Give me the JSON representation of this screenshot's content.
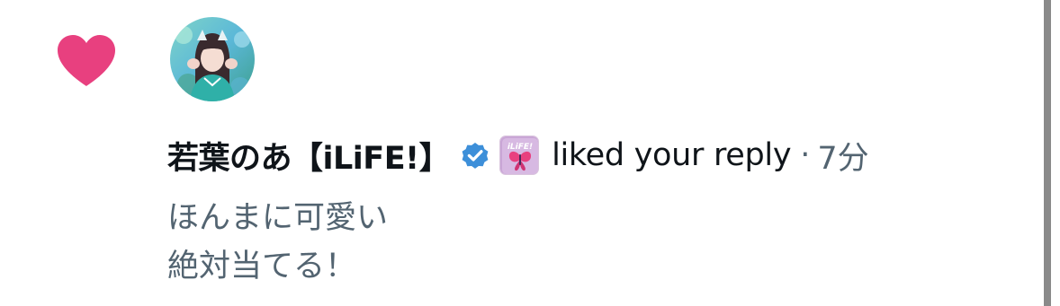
{
  "notification": {
    "type_icon": "heart-icon",
    "accent_color": "#e8407f",
    "avatar": {
      "description_icon": "user-avatar-photo"
    },
    "user": {
      "display_name": "若葉のあ【iLiFE!】",
      "verified_icon": "verified-badge-icon",
      "verified_color": "#3d8fd9",
      "affiliate_badge_text": "iLiFE!"
    },
    "action": "liked your reply",
    "separator": "·",
    "timestamp": "7分",
    "reply_lines": [
      "ほんまに可愛い",
      "絶対当てる！"
    ]
  }
}
